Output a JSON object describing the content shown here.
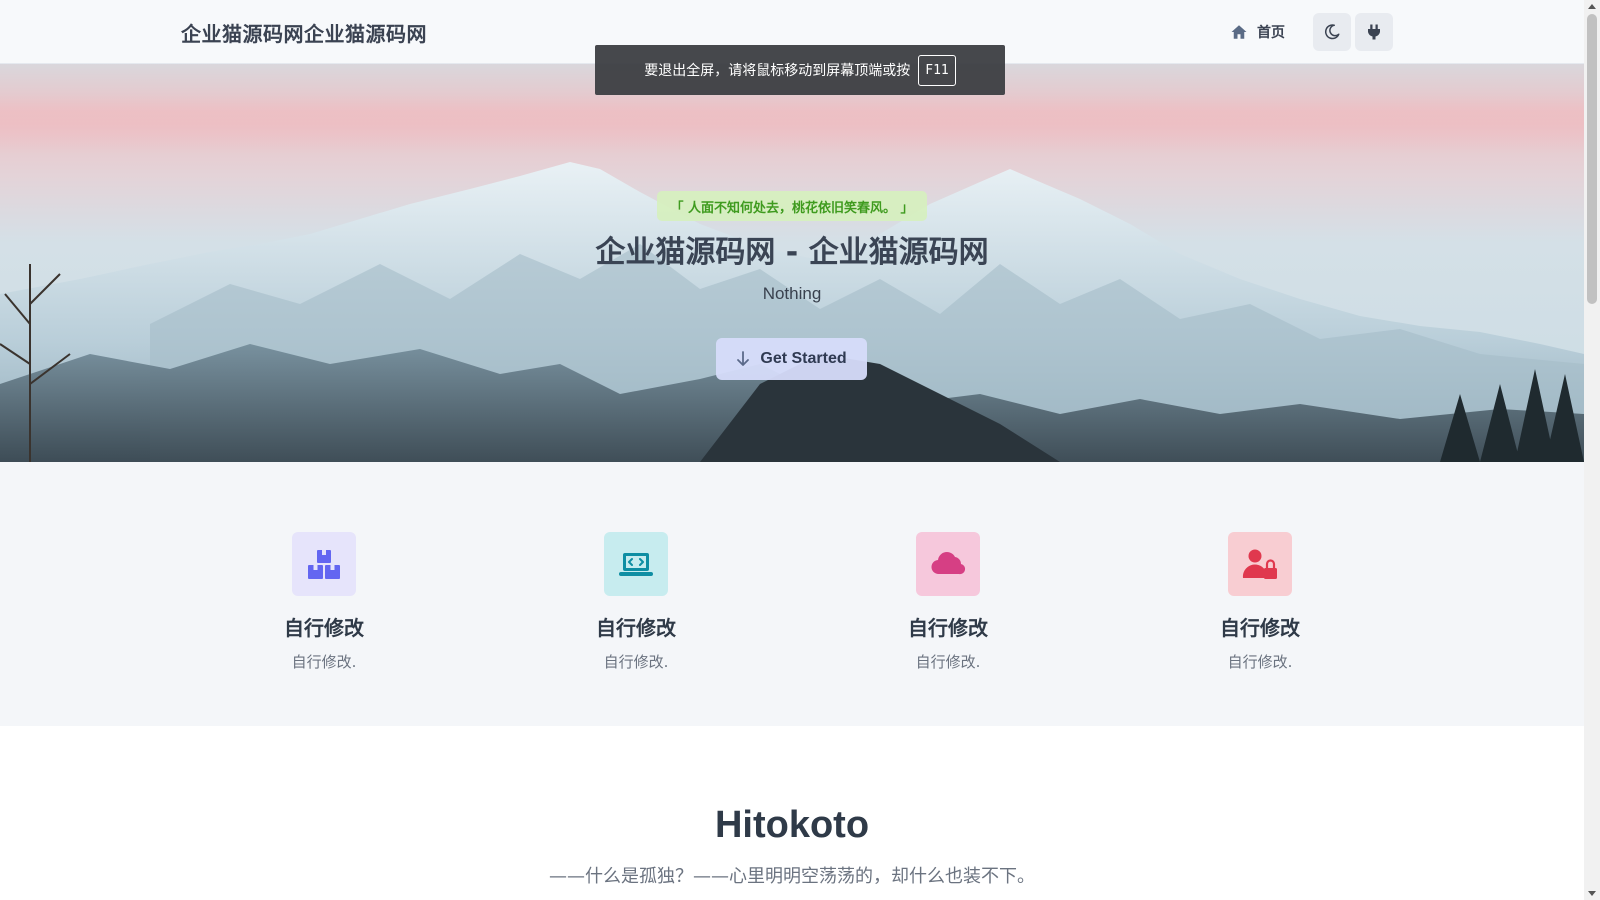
{
  "header": {
    "brand": "企业猫源码网企业猫源码网",
    "nav_home": "首页"
  },
  "toast": {
    "message": "要退出全屏，请将鼠标移动到屏幕顶端或按",
    "key": "F11"
  },
  "hero": {
    "quote": "「 人面不知何处去，桃花依旧笑春风。 」",
    "title": "企业猫源码网 - 企业猫源码网",
    "subtitle": "Nothing",
    "cta_label": "Get Started"
  },
  "features": [
    {
      "icon": "boxes-icon",
      "title": "自行修改",
      "desc": "自行修改.",
      "bg": "#e6e4fb",
      "color": "#6366f1"
    },
    {
      "icon": "laptop-code-icon",
      "title": "自行修改",
      "desc": "自行修改.",
      "bg": "#c7ecef",
      "color": "#0e8ea3"
    },
    {
      "icon": "cloud-icon",
      "title": "自行修改",
      "desc": "自行修改.",
      "bg": "#f6c8dc",
      "color": "#d63f84"
    },
    {
      "icon": "user-lock-icon",
      "title": "自行修改",
      "desc": "自行修改.",
      "bg": "#f8cdd2",
      "color": "#e0384e"
    }
  ],
  "hitokoto": {
    "heading": "Hitokoto",
    "text": "——什么是孤独？——心里明明空荡荡的，却什么也装不下。"
  }
}
